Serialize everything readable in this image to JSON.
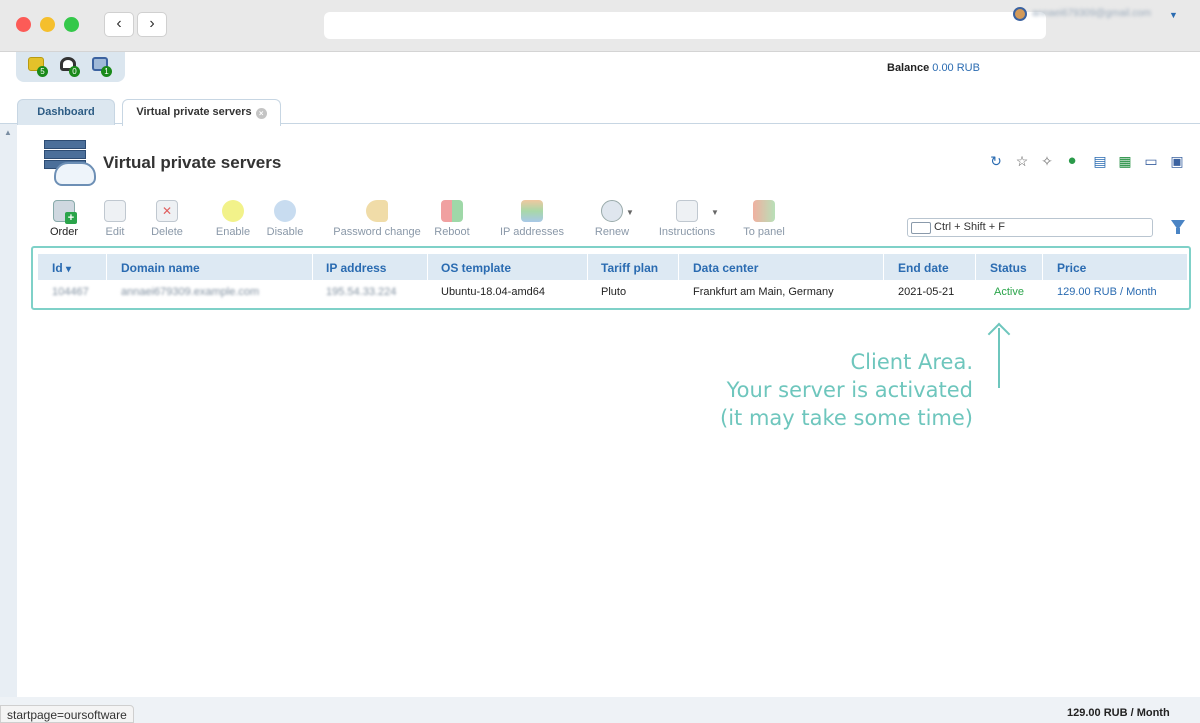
{
  "browser": {
    "back_label": "‹",
    "forward_label": "›",
    "url": ""
  },
  "notifications": [
    {
      "icon": "tickets-icon",
      "count": "5",
      "color": "#e3c12a"
    },
    {
      "icon": "support-icon",
      "count": "0",
      "color": "#333333"
    },
    {
      "icon": "monitor-icon",
      "count": "1",
      "color": "#3b62a0"
    }
  ],
  "header": {
    "balance_label": "Balance",
    "balance_value": "0.00 RUB",
    "user_email": "annaei679309@gmail.com"
  },
  "tabs": [
    {
      "label": "Dashboard"
    },
    {
      "label": "Virtual private servers",
      "close": "×"
    }
  ],
  "page": {
    "title": "Virtual private servers"
  },
  "header_icons": [
    "refresh-icon",
    "star-icon",
    "pin-icon",
    "globe-icon",
    "copy-icon",
    "excel-icon",
    "print-icon",
    "calendar-icon"
  ],
  "toolbar": [
    {
      "label": "Order",
      "icon": "order-icon",
      "active": true
    },
    {
      "label": "Edit",
      "icon": "edit-icon",
      "active": false
    },
    {
      "label": "Delete",
      "icon": "delete-icon",
      "active": false
    },
    {
      "label": "Enable",
      "icon": "enable-icon",
      "active": false
    },
    {
      "label": "Disable",
      "icon": "disable-icon",
      "active": false
    },
    {
      "label": "Password change",
      "icon": "key-icon",
      "active": false
    },
    {
      "label": "Reboot",
      "icon": "reboot-icon",
      "active": false
    },
    {
      "label": "IP addresses",
      "icon": "ip-icon",
      "active": false
    },
    {
      "label": "Renew",
      "icon": "renew-icon",
      "active": false
    },
    {
      "label": "Instructions",
      "icon": "instructions-icon",
      "active": false
    },
    {
      "label": "To panel",
      "icon": "to-panel-icon",
      "active": false
    }
  ],
  "search": {
    "placeholder": "Ctrl + Shift + F"
  },
  "table": {
    "sort_indicator": "▾",
    "columns": [
      "Id",
      "Domain name",
      "IP address",
      "OS template",
      "Tariff plan",
      "Data center",
      "End date",
      "Status",
      "Price"
    ],
    "rows": [
      {
        "id": "104467",
        "domain": "annaei679309.example.com",
        "ip": "195.54.33.224",
        "os": "Ubuntu-18.04-amd64",
        "tariff": "Pluto",
        "datacenter": "Frankfurt am Main, Germany",
        "end_date": "2021-05-21",
        "status": "Active",
        "price": "129.00 RUB / Month"
      }
    ]
  },
  "annotation": {
    "line1": "Client Area.",
    "line2": "Your server is activated",
    "line3": "(it may take some time)"
  },
  "footer": {
    "status_url": "startpage=oursoftware",
    "total": "129.00 RUB / Month"
  },
  "colors": {
    "accent": "#2a6bb1",
    "highlight": "#7fd1c8",
    "annotation": "#6ec6bd",
    "active_status": "#2aa44a"
  }
}
